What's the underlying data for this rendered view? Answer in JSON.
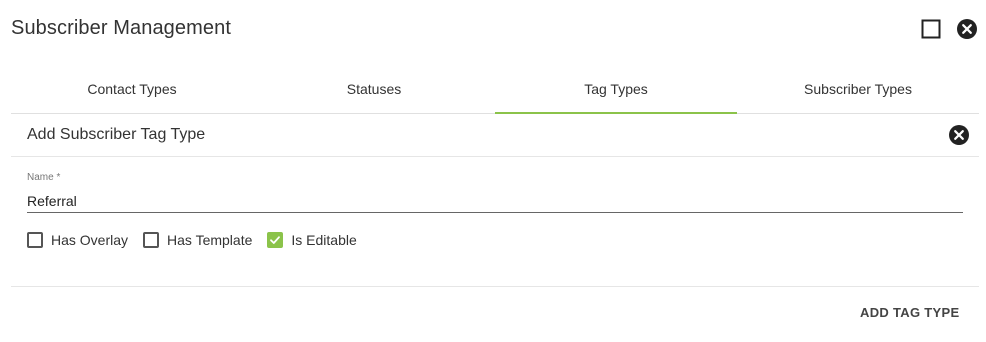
{
  "window": {
    "title": "Subscriber Management",
    "maximize_icon": "square-outline-icon",
    "close_icon": "close-circle-icon"
  },
  "tabs": [
    {
      "label": "Contact Types",
      "active": false
    },
    {
      "label": "Statuses",
      "active": false
    },
    {
      "label": "Tag Types",
      "active": true
    },
    {
      "label": "Subscriber Types",
      "active": false
    }
  ],
  "panel": {
    "title": "Add Subscriber Tag Type",
    "close_icon": "close-circle-icon"
  },
  "form": {
    "name_label": "Name *",
    "name_value": "Referral",
    "checkboxes": [
      {
        "label": "Has Overlay",
        "checked": false
      },
      {
        "label": "Has Template",
        "checked": false
      },
      {
        "label": "Is Editable",
        "checked": true
      }
    ]
  },
  "actions": {
    "add_label": "ADD TAG TYPE"
  },
  "colors": {
    "accent": "#8bc34a",
    "text": "#333333",
    "divider": "#e6e6e6"
  }
}
